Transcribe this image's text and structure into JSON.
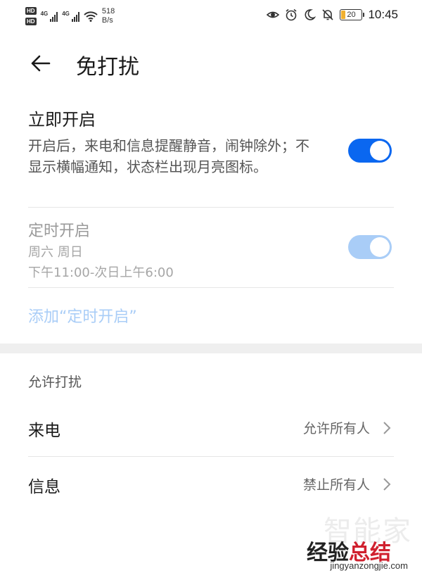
{
  "status_bar": {
    "hd_1": "HD",
    "hd_2": "HD",
    "net_1": "4G",
    "net_2": "4G",
    "speed_value": "518",
    "speed_unit": "B/s",
    "battery": "20",
    "time": "10:45",
    "icons": [
      "eye-icon",
      "alarm-icon",
      "moon-icon",
      "bell-off-icon",
      "battery-icon"
    ]
  },
  "header": {
    "back_icon": "arrow-left-icon",
    "title": "免打扰"
  },
  "immediate": {
    "title": "立即开启",
    "description": "开启后，来电和信息提醒静音，闹钟除外；不显示横幅通知，状态栏出现月亮图标。",
    "enabled": true
  },
  "schedule": {
    "title": "定时开启",
    "days": "周六 周日",
    "time_range": "下午11:00-次日上午6:00",
    "enabled": true,
    "add_label": "添加“定时开启”"
  },
  "allow": {
    "section_label": "允许打扰",
    "items": [
      {
        "label": "来电",
        "value": "允许所有人"
      },
      {
        "label": "信息",
        "value": "禁止所有人"
      }
    ]
  },
  "watermark": {
    "ghost": "智能家",
    "main_black": "经验",
    "main_red": "总结",
    "url": "jingyanzongjie.com"
  },
  "colors": {
    "toggle_on": "#0a67f0",
    "toggle_disabled": "#a9cdf7",
    "link_disabled": "#a9cdf7",
    "battery_low": "#f0b030"
  }
}
